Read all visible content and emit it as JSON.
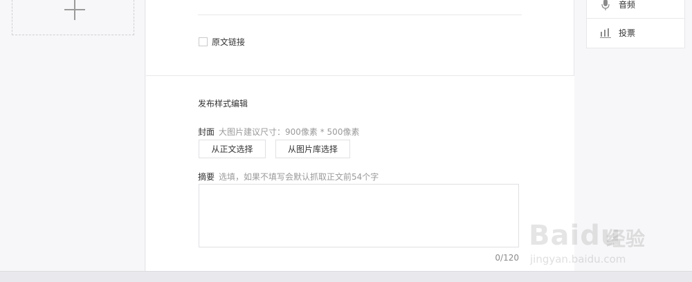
{
  "editor": {
    "original_link_label": "原文链接"
  },
  "publish_settings": {
    "title": "发布样式编辑",
    "cover": {
      "label": "封面",
      "hint": "大图片建议尺寸：900像素 * 500像素",
      "btn_from_body": "从正文选择",
      "btn_from_library": "从图片库选择"
    },
    "summary": {
      "label": "摘要",
      "hint": "选填，如果不填写会默认抓取正文前54个字",
      "value": "",
      "counter": "0/120"
    }
  },
  "right_panel": {
    "items": [
      {
        "label": "音频",
        "icon": "microphone-icon"
      },
      {
        "label": "投票",
        "icon": "bar-chart-icon"
      }
    ]
  },
  "watermark": {
    "brand": "Baidu",
    "cn": "经验",
    "url": "jingyan.baidu.com"
  },
  "colors": {
    "border": "#e7e7eb",
    "hint": "#9a9a9a",
    "background": "#f7f7f9"
  }
}
